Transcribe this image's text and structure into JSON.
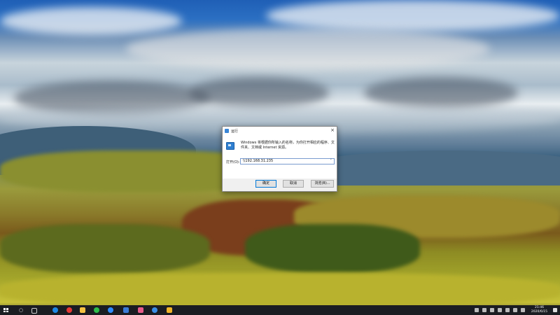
{
  "dialog": {
    "title": "运行",
    "close_glyph": "×",
    "description": "Windows 将根据你所输入的名称，为你打开相应的程序、文件夹、文档或 Internet 资源。",
    "open_label": "打开(O):",
    "open_value": "\\\\192.168.31.235",
    "dropdown_glyph": "˅",
    "ok_label": "确定",
    "cancel_label": "取消",
    "browse_label": "浏览(B)..."
  },
  "taskbar": {
    "time": "21:46",
    "date": "2020/6/15",
    "apps": [
      {
        "name": "edge-icon",
        "color": "#1e88e5"
      },
      {
        "name": "chrome-icon",
        "color": "#e53935"
      },
      {
        "name": "files-icon",
        "color": "#f5c242"
      },
      {
        "name": "wechat-icon",
        "color": "#2dbd4a"
      },
      {
        "name": "qq-icon",
        "color": "#2f8cff"
      },
      {
        "name": "app-icon",
        "color": "#3b7bd6"
      },
      {
        "name": "paint-icon",
        "color": "#e85c8a"
      },
      {
        "name": "browser-icon",
        "color": "#3a8ee6"
      },
      {
        "name": "folder-icon",
        "color": "#f0b429"
      }
    ]
  }
}
